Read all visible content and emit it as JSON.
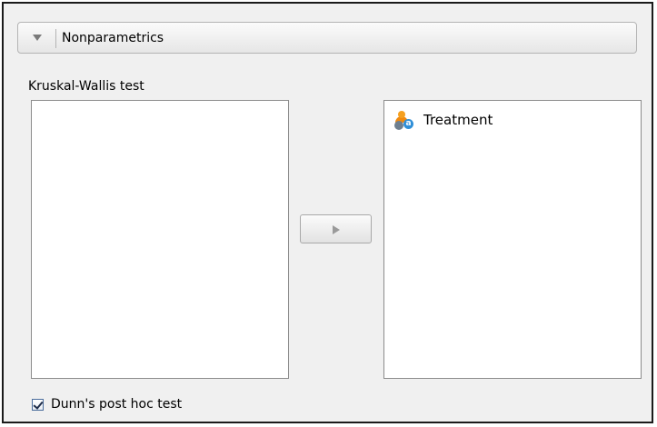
{
  "section": {
    "title": "Nonparametrics",
    "toggle_icon": "collapse-triangle-icon"
  },
  "kruskal_wallis": {
    "label": "Kruskal-Wallis test",
    "assigned_variables": [],
    "available_variables": [
      {
        "name": "Treatment",
        "icon": "nominal-text-variable-icon"
      }
    ]
  },
  "assign_button": {
    "icon": "right-arrow-icon"
  },
  "dunn_checkbox": {
    "label": "Dunn's post hoc test",
    "checked": true
  },
  "colors": {
    "panel_background": "#f0f0f0",
    "list_background": "#ffffff",
    "border": "#8c8c8c"
  }
}
